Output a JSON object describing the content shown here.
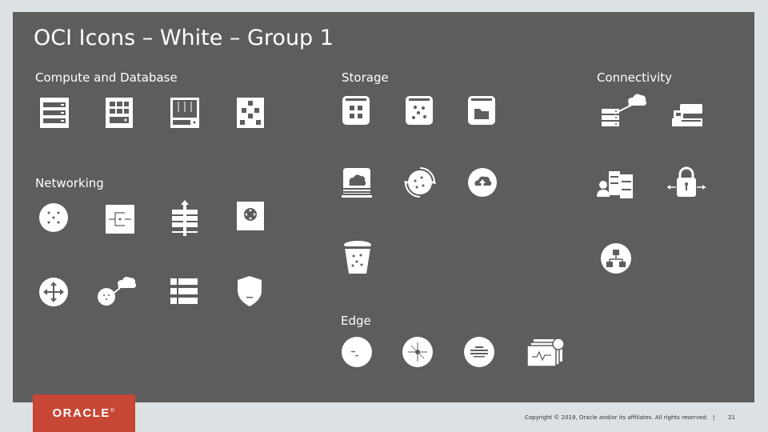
{
  "slide": {
    "title": "OCI Icons – White – Group 1",
    "sections": {
      "compute": "Compute and Database",
      "storage": "Storage",
      "connectivity": "Connectivity",
      "networking": "Networking",
      "edge": "Edge"
    }
  },
  "icons": {
    "compute": [
      "bare-metal-compute-icon",
      "virtual-machine-icon",
      "container-engine-icon",
      "autonomous-database-icon"
    ],
    "storage": [
      "block-storage-icon",
      "object-storage-icon",
      "file-storage-icon",
      "storage-gateway-icon",
      "backup-restore-icon",
      "archive-storage-icon",
      "bucket-icon"
    ],
    "connectivity": [
      "fastconnect-icon",
      "customer-premises-icon",
      "remote-peering-icon",
      "vpn-connect-icon",
      "dynamic-routing-gateway-icon"
    ],
    "networking": [
      "virtual-cloud-network-icon",
      "subnet-icon",
      "internet-gateway-icon",
      "route-table-icon",
      "load-balancer-icon",
      "service-gateway-icon",
      "security-list-icon",
      "security-shield-icon"
    ],
    "edge": [
      "dns-icon",
      "traffic-management-icon",
      "waf-icon",
      "health-check-icon"
    ]
  },
  "footer": {
    "logo_text": "ORACLE",
    "logo_mark": "®",
    "copyright": "Copyright © 2019, Oracle and/or its affiliates. All rights reserved.",
    "separator": "|",
    "page_number": "21"
  },
  "colors": {
    "panel": "#5d5d5d",
    "background": "#dce1e4",
    "icon": "#ffffff",
    "brand": "#c74634"
  }
}
